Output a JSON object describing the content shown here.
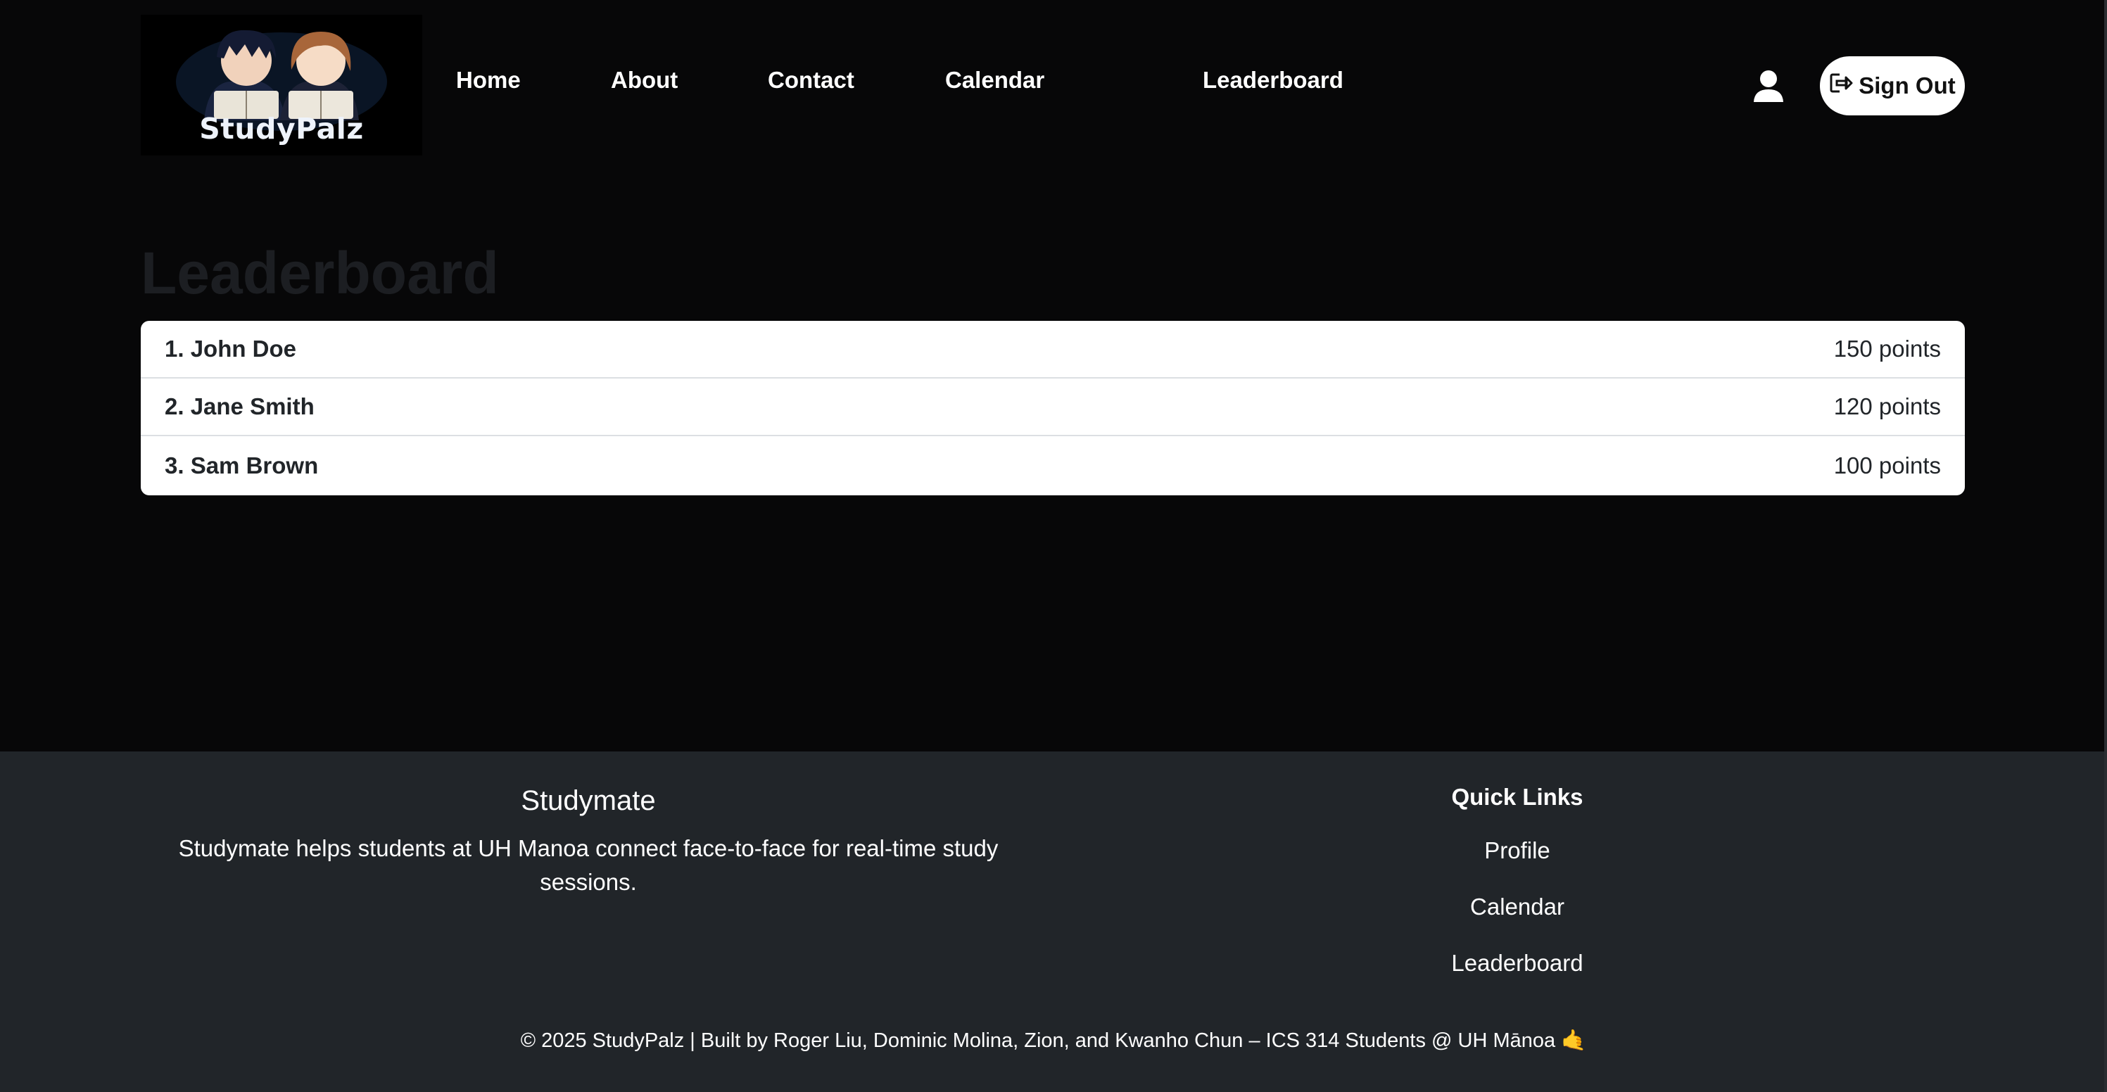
{
  "navbar": {
    "logo_text": "StudyPalz",
    "links": [
      {
        "label": "Home"
      },
      {
        "label": "About"
      },
      {
        "label": "Contact"
      },
      {
        "label": "Calendar"
      },
      {
        "label": "Leaderboard"
      }
    ],
    "profile_icon": "user-icon",
    "signout_icon": "sign-out-icon",
    "signout_label": "Sign Out"
  },
  "main": {
    "title": "Leaderboard",
    "entries": [
      {
        "name": "1. John Doe",
        "points": "150 points"
      },
      {
        "name": "2. Jane Smith",
        "points": "120 points"
      },
      {
        "name": "3. Sam Brown",
        "points": "100 points"
      }
    ]
  },
  "footer": {
    "brand": "Studymate",
    "description": "Studymate helps students at UH Manoa connect face-to-face for real-time study sessions.",
    "quick_links_title": "Quick Links",
    "quick_links": [
      {
        "label": "Profile"
      },
      {
        "label": "Calendar"
      },
      {
        "label": "Leaderboard"
      }
    ],
    "copyright": "© 2025 StudyPalz | Built by Roger Liu, Dominic Molina, Zion, and Kwanho Chun – ICS 314 Students @ UH Mānoa 🤙"
  },
  "colors": {
    "page_background": "#070708",
    "footer_background": "#212529",
    "card_background": "#ffffff",
    "title_color": "#1c1e22"
  }
}
